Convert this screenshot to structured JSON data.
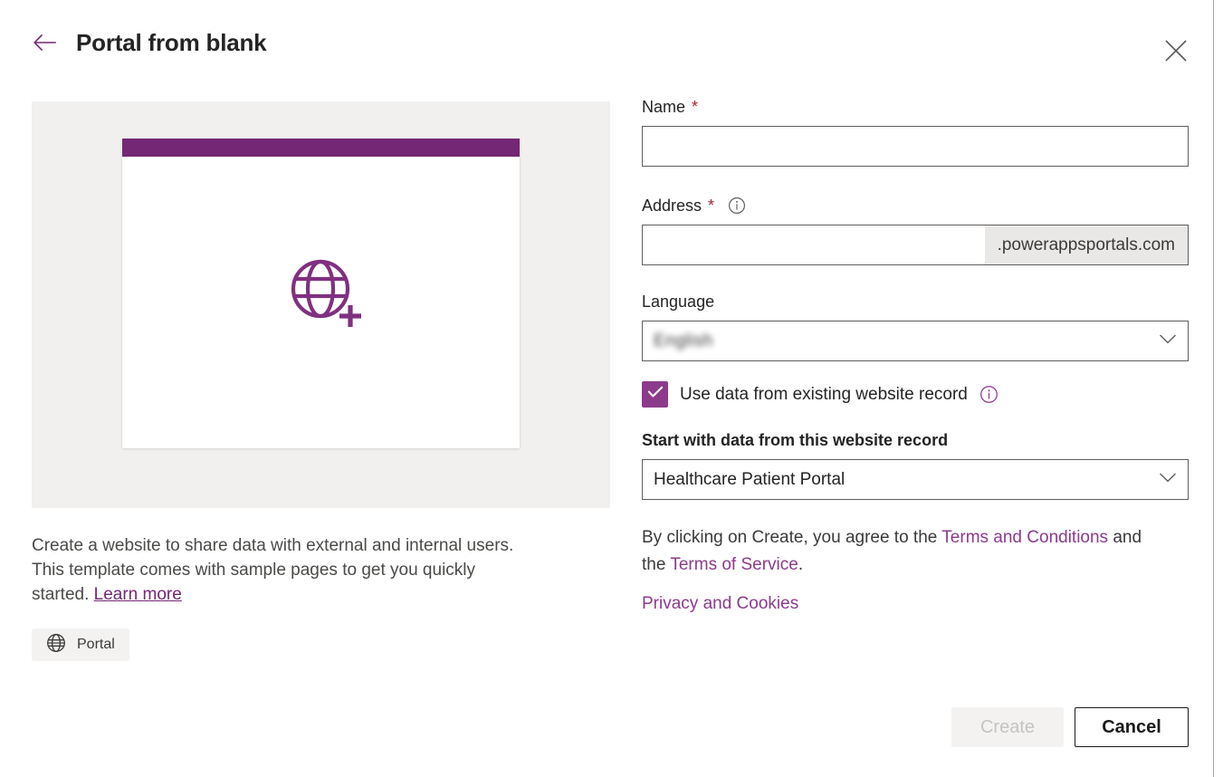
{
  "header": {
    "title": "Portal from blank",
    "back_icon": "arrow-left-icon",
    "close_icon": "close-icon"
  },
  "preview": {
    "icon": "globe-plus-icon",
    "header_bar_color": "#742774",
    "background_color": "#f1f0ef"
  },
  "left": {
    "description_part1": "Create a website to share data with external and internal users. This template comes with sample pages to get you quickly started. ",
    "learn_more_label": "Learn more",
    "tag": {
      "icon": "globe-icon",
      "label": "Portal"
    }
  },
  "form": {
    "name": {
      "label": "Name",
      "required_marker": "*",
      "value": "",
      "placeholder": ""
    },
    "address": {
      "label": "Address",
      "required_marker": "*",
      "info_icon": "info-icon",
      "value": "",
      "placeholder": "",
      "suffix": ".powerappsportals.com"
    },
    "language": {
      "label": "Language",
      "value": "English",
      "value_redacted": true,
      "chevron_icon": "chevron-down-icon"
    },
    "use_existing_record": {
      "label": "Use data from existing website record",
      "checked": true,
      "check_icon": "checkmark-icon",
      "info_icon": "info-icon"
    },
    "website_record": {
      "label": "Start with data from this website record",
      "value": "Healthcare Patient Portal",
      "chevron_icon": "chevron-down-icon"
    }
  },
  "legal": {
    "prefix": "By clicking on Create, you agree to the ",
    "terms_and_conditions": "Terms and Conditions",
    "middle": " and the ",
    "terms_of_service": "Terms of Service",
    "suffix": ".",
    "privacy_and_cookies": "Privacy and Cookies"
  },
  "footer": {
    "create_label": "Create",
    "create_disabled": true,
    "cancel_label": "Cancel"
  },
  "colors": {
    "accent_purple": "#742774",
    "link_purple": "#8c3a8c",
    "required_red": "#a4262c"
  }
}
